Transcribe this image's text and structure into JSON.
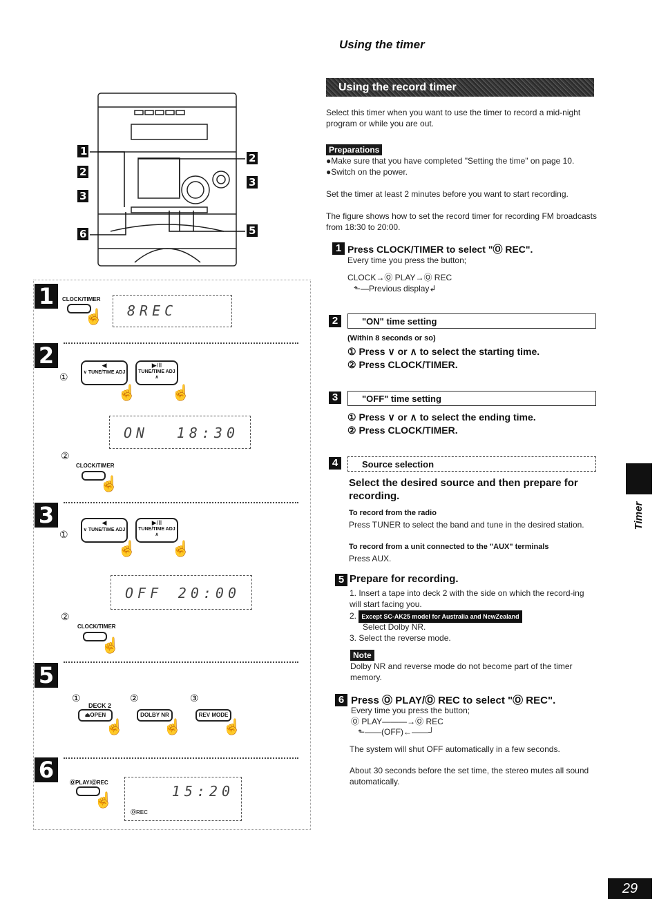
{
  "page": {
    "title": "Using the timer",
    "section_banner": "Using the record timer",
    "intro": "Select this timer when you want to use the timer to record a mid-night program or while you are out.",
    "side_tab_label": "Timer",
    "page_number": "29"
  },
  "preparations": {
    "label": "Preparations",
    "bullets": [
      "Make sure that you have completed \"Setting the time\" on page 10.",
      "Switch on the power."
    ],
    "note1": "Set the timer at least 2 minutes before you want to start recording.",
    "note2": "The figure shows how to set the record timer for recording FM broadcasts from 18:30 to 20:00."
  },
  "steps": [
    {
      "num": "1",
      "heading": "Press CLOCK/TIMER to select \"Ⓞ REC\".",
      "body": "Every time you press the button;",
      "sequence": "CLOCK→Ⓞ PLAY→Ⓞ REC",
      "sequence_return": "⬑—Previous display↲"
    },
    {
      "num": "2",
      "box_title": "\"ON\" time setting",
      "note": "(Within 8 seconds or so)",
      "line1": "① Press ∨ or ∧ to select the starting time.",
      "line2": "② Press CLOCK/TIMER."
    },
    {
      "num": "3",
      "box_title": "\"OFF\" time setting",
      "line1": "① Press ∨ or ∧ to select the ending time.",
      "line2": "② Press CLOCK/TIMER."
    },
    {
      "num": "4",
      "box_title": "Source selection",
      "heading": "Select the desired source and then prepare for recording.",
      "radio_title": "To record from the radio",
      "radio_body": "Press TUNER to select the band and tune in the desired station.",
      "aux_title": "To record from a unit connected to the \"AUX\" terminals",
      "aux_body": "Press AUX."
    },
    {
      "num": "5",
      "heading": "Prepare for recording.",
      "item1": "1.  Insert a tape into deck 2 with the side on which the record-ing will start facing you.",
      "item2_prefix": "2.",
      "item2_tag": "Except SC-AK25 model for Australia and NewZealand",
      "item2_body": "Select Dolby NR.",
      "item3": "3.  Select the reverse mode.",
      "note_label": "Note",
      "note_body": "Dolby NR and reverse mode do not become part of the timer memory."
    },
    {
      "num": "6",
      "heading": "Press Ⓞ PLAY/Ⓞ REC to select \"Ⓞ REC\".",
      "body": "Every time you press the button;",
      "sequence": "Ⓞ PLAY———→Ⓞ REC",
      "sequence_return": "⬑——(OFF)←——┘",
      "after1": "The system will shut OFF automatically in a few seconds.",
      "after2": "About 30 seconds before the set time, the stereo mutes all sound automatically."
    }
  ],
  "illustration": {
    "device_callouts": [
      "1",
      "2",
      "3",
      "2",
      "3",
      "5",
      "6"
    ],
    "step1": {
      "button": "CLOCK/TIMER",
      "display": "8REC"
    },
    "step2": {
      "circ1": "①",
      "circ2": "②",
      "btn_down": "∨ TUNE/TIME ADJ",
      "btn_down_sym": "◀",
      "btn_up": "TUNE/TIME ADJ ∧",
      "btn_up_sym": "▶/II",
      "display_left": "ON",
      "display_right": "18:30",
      "button": "CLOCK/TIMER"
    },
    "step3": {
      "circ1": "①",
      "circ2": "②",
      "btn_down": "∨ TUNE/TIME ADJ",
      "btn_down_sym": "◀",
      "btn_up": "TUNE/TIME ADJ ∧",
      "btn_up_sym": "▶/II",
      "display_left": "OFF",
      "display_right": "20:00",
      "button": "CLOCK/TIMER"
    },
    "step5": {
      "circ1": "①",
      "circ2": "②",
      "circ3": "③",
      "deck_label": "DECK 2",
      "btn_open": "⏏OPEN",
      "btn_dolby": "DOLBY NR",
      "btn_rev": "REV MODE"
    },
    "step6": {
      "button": "ⓄPLAY/ⓄREC",
      "display": "15:20",
      "display_sub": "ⓄREC"
    }
  }
}
